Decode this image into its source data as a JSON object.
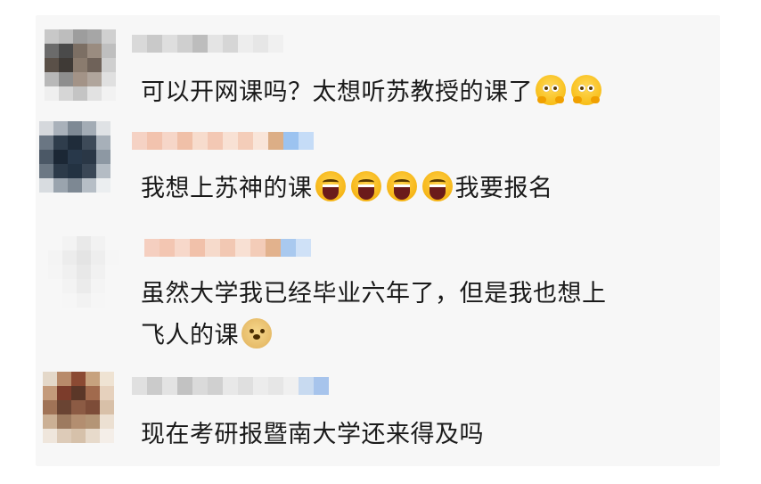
{
  "comments": [
    {
      "text": "可以开网课吗？太想听苏教授的课了",
      "emojis": [
        "hug-emoji",
        "hug-emoji"
      ]
    },
    {
      "text_before": "我想上苏神的课",
      "emojis": [
        "laugh-emoji",
        "laugh-emoji",
        "laugh-emoji",
        "laugh-emoji"
      ],
      "text_after": "我要报名"
    },
    {
      "line1": "虽然大学我已经毕业六年了，但是我也想上",
      "line2": "飞人的课",
      "emojis": [
        "doge-emoji"
      ]
    },
    {
      "text": "现在考研报暨南大学还来得及吗"
    }
  ],
  "colors": {
    "card_bg": "#f7f7f7",
    "text": "#1a1a1a"
  }
}
